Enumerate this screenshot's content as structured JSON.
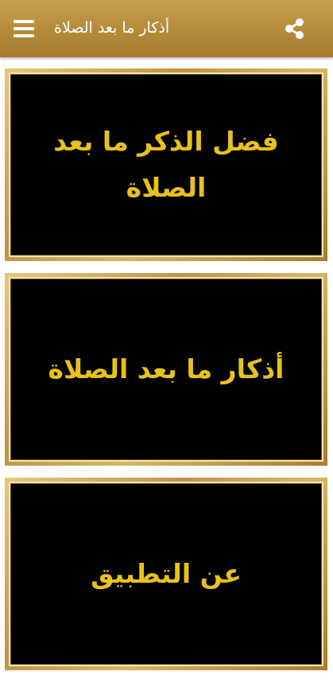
{
  "app_bar": {
    "title": "أذكار ما بعد الصلاة",
    "menu_icon": "hamburger-menu-icon",
    "share_icon": "share-icon",
    "color": "#b48a3a"
  },
  "menu": {
    "items": [
      {
        "label": "فضل الذكر ما بعد الصلاة"
      },
      {
        "label": "أذكار ما بعد الصلاة"
      },
      {
        "label": "عن التطبيق"
      }
    ]
  },
  "colors": {
    "card_text": "#e8c21a",
    "card_background": "#000000",
    "card_frame": "#c9a04e"
  }
}
